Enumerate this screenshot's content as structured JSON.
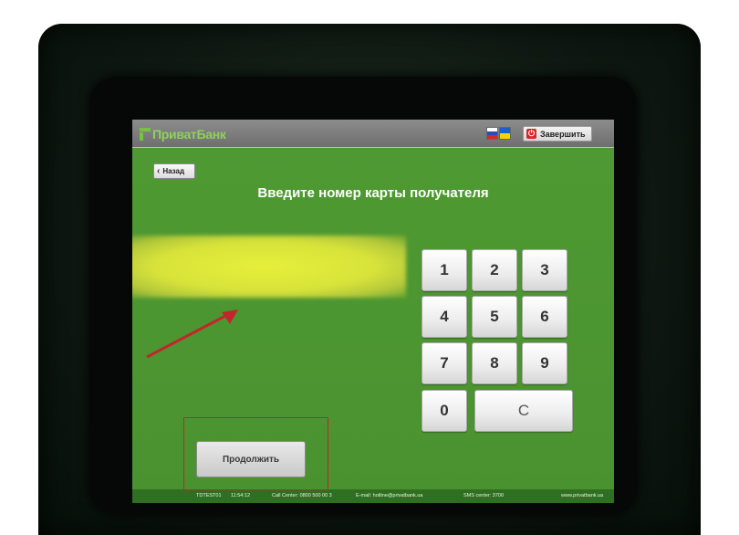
{
  "header": {
    "logo_text": "ПриватБанк",
    "finish_label": "Завершить"
  },
  "nav": {
    "back_label": "Назад"
  },
  "main": {
    "title": "Введите номер карты получателя",
    "continue_label": "Продолжить"
  },
  "keypad": {
    "keys": [
      "1",
      "2",
      "3",
      "4",
      "5",
      "6",
      "7",
      "8",
      "9",
      "0",
      "C"
    ]
  },
  "footer": {
    "version": "TDTEST01",
    "time": "11:54:12",
    "call_center": "Call Center: 0800 500 00 3",
    "email": "E-mail: hotline@privatbank.ua",
    "sms": "SMS center: 3700",
    "site": "www.privatbank.ua"
  },
  "colors": {
    "screen_green": "#4f9a33",
    "field_yellow": "#e6ef3a",
    "annotation_red": "#c2262b"
  }
}
